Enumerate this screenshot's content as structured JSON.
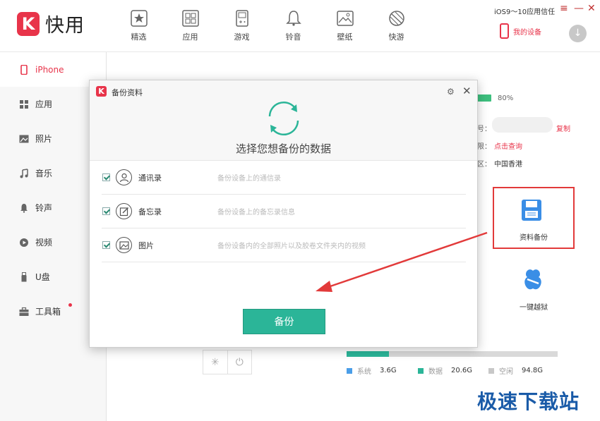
{
  "app": {
    "logo_letter": "K",
    "name": "快用"
  },
  "nav": [
    {
      "label": "精选",
      "icon": "star-icon"
    },
    {
      "label": "应用",
      "icon": "apps-grid-icon"
    },
    {
      "label": "游戏",
      "icon": "gamepad-icon"
    },
    {
      "label": "铃音",
      "icon": "bell-icon"
    },
    {
      "label": "壁纸",
      "icon": "wallpaper-icon"
    },
    {
      "label": "快游",
      "icon": "leaf-icon"
    }
  ],
  "header": {
    "trust_text": "iOS9～10应用信任",
    "my_device": "我的设备"
  },
  "sidebar": [
    {
      "label": "iPhone",
      "icon": "phone-icon",
      "active": true
    },
    {
      "label": "应用",
      "icon": "apps-grid-icon"
    },
    {
      "label": "照片",
      "icon": "photo-icon"
    },
    {
      "label": "音乐",
      "icon": "music-icon"
    },
    {
      "label": "铃声",
      "icon": "bell-icon"
    },
    {
      "label": "视频",
      "icon": "play-icon"
    },
    {
      "label": "U盘",
      "icon": "usb-icon"
    },
    {
      "label": "工具箱",
      "icon": "toolbox-icon",
      "badge": true
    }
  ],
  "device_info": {
    "battery": "80%",
    "serial_suffix": "号：",
    "copy": "复制",
    "warranty_suffix": "限：",
    "check": "点击查询",
    "region_suffix": "区：",
    "region": "中国香港"
  },
  "tools": {
    "backup": "资料备份",
    "jailbreak": "一键越狱"
  },
  "storage": {
    "system_fraction": 0.2,
    "legend": [
      {
        "name": "系统",
        "value": "3.6G",
        "color": "#4a9ee8"
      },
      {
        "name": "数据",
        "value": "20.6G",
        "color": "#2bb598"
      },
      {
        "name": "空闲",
        "value": "94.8G",
        "color": "#c8c8c8"
      }
    ]
  },
  "watermark": "极速下载站",
  "dialog": {
    "logo_letter": "K",
    "title": "备份资料",
    "heading": "选择您想备份的数据",
    "items": [
      {
        "label": "通讯录",
        "desc": "备份设备上的通信录",
        "icon": "contact-icon",
        "checked": true
      },
      {
        "label": "备忘录",
        "desc": "备份设备上的备忘录信息",
        "icon": "note-edit-icon",
        "checked": true
      },
      {
        "label": "图片",
        "desc": "备份设备内的全部照片以及胶卷文件夹内的视频",
        "icon": "image-icon",
        "checked": true
      }
    ],
    "button": "备份"
  }
}
